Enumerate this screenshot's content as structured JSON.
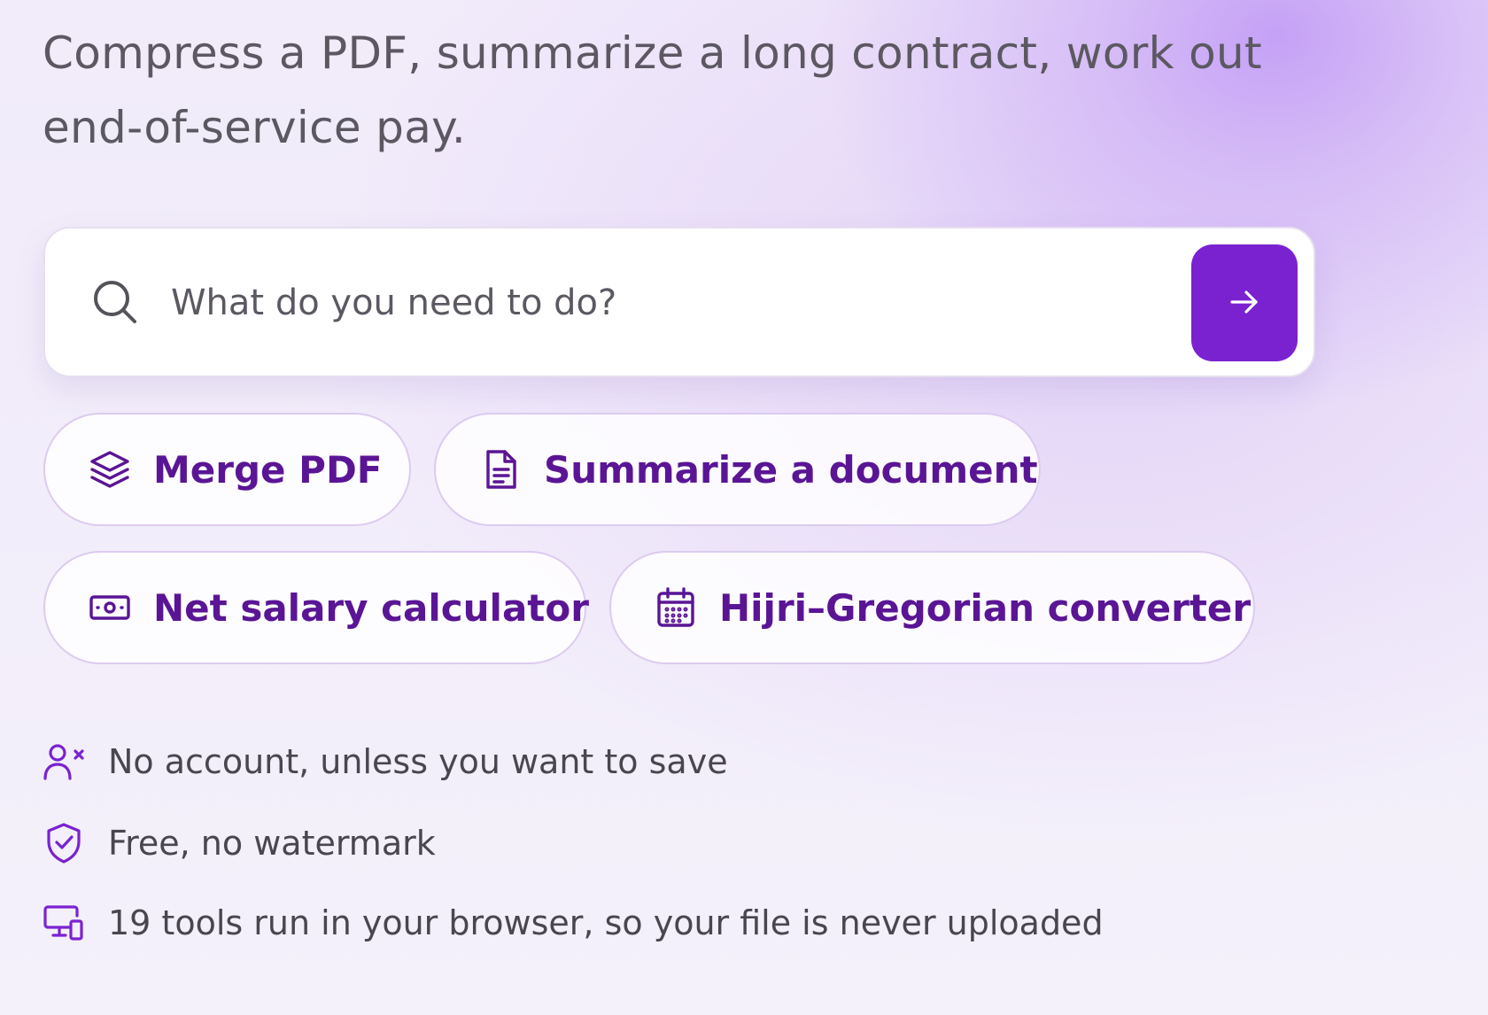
{
  "hero": {
    "headline": "Compress a PDF, summarize a long contract, work out end-of-service pay."
  },
  "search": {
    "placeholder": "What do you need to do?",
    "value": "",
    "icon": "search-icon",
    "submit_icon": "arrow-right-icon",
    "accent_color": "#7a22d0"
  },
  "quick_actions": [
    {
      "label": "Merge PDF",
      "icon": "layers-icon"
    },
    {
      "label": "Summarize a document",
      "icon": "document-icon"
    },
    {
      "label": "Net salary calculator",
      "icon": "banknote-icon"
    },
    {
      "label": "Hijri–Gregorian converter",
      "icon": "calendar-icon"
    }
  ],
  "features": [
    {
      "label": "No account, unless you want to save",
      "icon": "user-x-icon"
    },
    {
      "label": "Free, no watermark",
      "icon": "shield-check-icon"
    },
    {
      "label": "19 tools run in your browser, so your file is never uploaded",
      "icon": "devices-icon"
    }
  ],
  "colors": {
    "chip_text": "#5a1595",
    "icon_purple": "#7a22d0",
    "body_text": "#4a4650"
  }
}
